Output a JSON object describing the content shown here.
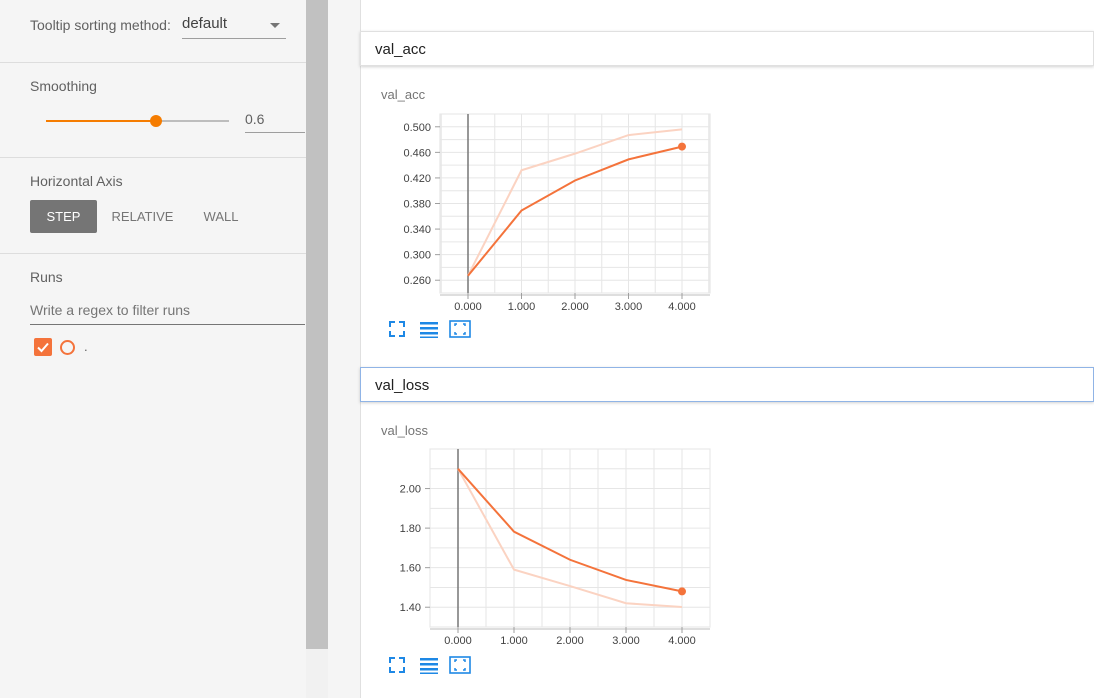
{
  "sidebar": {
    "tooltip_sorting": {
      "label": "Tooltip sorting method:",
      "value": "default"
    },
    "smoothing": {
      "label": "Smoothing",
      "value": "0.6",
      "fraction": 0.6
    },
    "horizontal_axis": {
      "label": "Horizontal Axis",
      "options": [
        "STEP",
        "RELATIVE",
        "WALL"
      ],
      "selected": "STEP"
    },
    "runs": {
      "label": "Runs",
      "filter_placeholder": "Write a regex to filter runs",
      "items": [
        {
          "name": ".",
          "checked": true,
          "color": "#f4733b"
        }
      ]
    }
  },
  "main": {
    "groups": [
      {
        "header": "val_acc",
        "chart_title": "val_acc"
      },
      {
        "header": "val_loss",
        "chart_title": "val_loss"
      }
    ]
  },
  "colors": {
    "accent": "#f57c00",
    "run": "#f4733b",
    "run_raw": "#fbd3c2",
    "icon": "#1e88e5"
  },
  "chart_data": [
    {
      "type": "line",
      "title": "val_acc",
      "x": [
        0,
        1,
        2,
        3,
        4
      ],
      "xticks": [
        "0.000",
        "1.000",
        "2.000",
        "3.000",
        "4.000"
      ],
      "yticks": [
        "0.500",
        "0.460",
        "0.420",
        "0.380",
        "0.340",
        "0.300",
        "0.260"
      ],
      "ytick_values": [
        0.5,
        0.46,
        0.42,
        0.38,
        0.34,
        0.3,
        0.26
      ],
      "xlim": [
        -0.5,
        4.5
      ],
      "ylim": [
        0.24,
        0.52
      ],
      "series": [
        {
          "values": [
            0.267,
            0.369,
            0.416,
            0.449,
            0.469
          ],
          "role": "smoothed"
        },
        {
          "values": [
            0.267,
            0.432,
            0.458,
            0.487,
            0.496
          ],
          "role": "raw"
        }
      ],
      "grid": true
    },
    {
      "type": "line",
      "title": "val_loss",
      "x": [
        0,
        1,
        2,
        3,
        4
      ],
      "xticks": [
        "0.000",
        "1.000",
        "2.000",
        "3.000",
        "4.000"
      ],
      "yticks": [
        "2.00",
        "1.80",
        "1.60",
        "1.40"
      ],
      "ytick_values": [
        2.0,
        1.8,
        1.6,
        1.4
      ],
      "xlim": [
        -0.5,
        4.5
      ],
      "ylim": [
        1.3,
        2.2
      ],
      "series": [
        {
          "values": [
            2.1,
            1.782,
            1.64,
            1.538,
            1.48
          ],
          "role": "smoothed"
        },
        {
          "values": [
            2.1,
            1.59,
            1.507,
            1.42,
            1.401
          ],
          "role": "raw"
        }
      ],
      "grid": true
    }
  ]
}
